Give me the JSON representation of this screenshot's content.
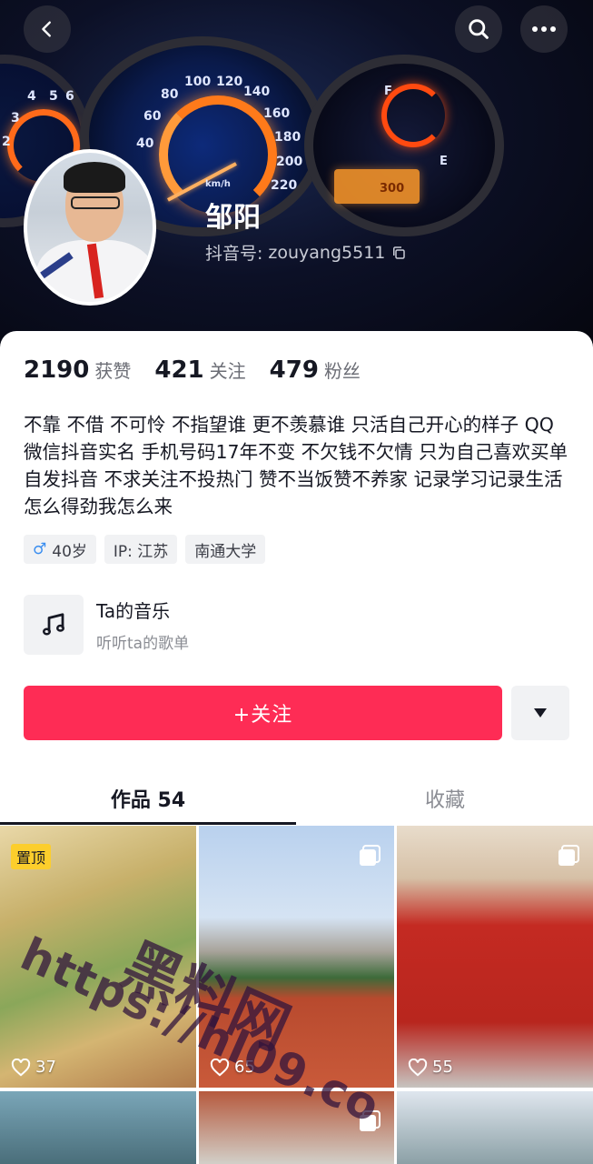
{
  "header": {
    "back_icon": "chevron-left-icon",
    "search_icon": "search-icon",
    "more_icon": "more-horizontal-icon",
    "cover_ticks": [
      "40",
      "60",
      "80",
      "100",
      "120",
      "140",
      "160",
      "180",
      "200",
      "220",
      "5",
      "6",
      "4",
      "3",
      "2"
    ],
    "cover_unit": "km/h",
    "cover_fuel_e": "E",
    "cover_fuel_f": "F",
    "cover_odo": "300"
  },
  "profile": {
    "name": "邹阳",
    "douyin_id_label": "抖音号:",
    "douyin_id": "zouyang5511",
    "copy_icon": "copy-icon"
  },
  "stats": [
    {
      "value": "2190",
      "label": "获赞"
    },
    {
      "value": "421",
      "label": "关注"
    },
    {
      "value": "479",
      "label": "粉丝"
    }
  ],
  "bio": "不靠 不借 不可怜 不指望谁 更不羡慕谁 只活自己开心的样子 QQ微信抖音实名 手机号码17年不变 不欠钱不欠情 只为自己喜欢买单 自发抖音 不求关注不投热门  赞不当饭赞不养家 记录学习记录生活 怎么得劲我怎么来",
  "tags": {
    "gender_symbol": "♂",
    "age": "40岁",
    "ip": "IP:  江苏",
    "school": "南通大学"
  },
  "music": {
    "title": "Ta的音乐",
    "subtitle": "听听ta的歌单",
    "icon": "music-note-icon"
  },
  "actions": {
    "follow_label": "+关注",
    "follow_color": "#fe2c55",
    "dropdown_icon": "caret-down-icon"
  },
  "tabs": [
    {
      "label": "作品 54",
      "active": true
    },
    {
      "label": "收藏",
      "active": false
    }
  ],
  "grid": [
    {
      "pinned": true,
      "pin_label": "置顶",
      "likes": "37",
      "multi": false
    },
    {
      "pinned": false,
      "likes": "65",
      "multi": true
    },
    {
      "pinned": false,
      "likes": "55",
      "multi": true
    },
    {
      "pinned": false,
      "likes": "",
      "multi": false
    },
    {
      "pinned": false,
      "likes": "",
      "multi": true
    },
    {
      "pinned": false,
      "likes": "",
      "multi": false
    }
  ],
  "watermark": {
    "url_text": "https://hl09.co",
    "brand_text": "黑料网"
  }
}
